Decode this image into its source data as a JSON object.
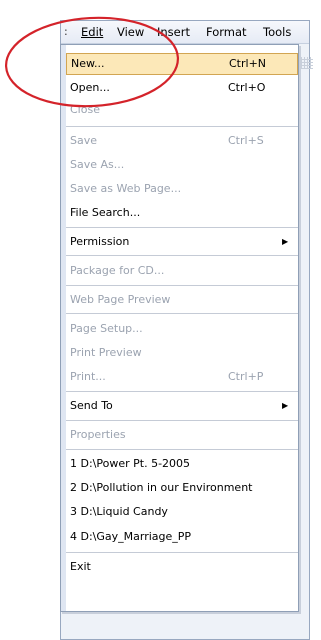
{
  "menubar": {
    "sliver": ":",
    "items": [
      "Edit",
      "View",
      "Insert",
      "Format",
      "Tools"
    ],
    "mnemonic_index": [
      0,
      0,
      0,
      1,
      0
    ]
  },
  "menu": {
    "new": {
      "label": "New...",
      "shortcut": "Ctrl+N"
    },
    "open": {
      "label": "Open...",
      "shortcut": "Ctrl+O"
    },
    "close": {
      "label": "Close"
    },
    "save": {
      "label": "Save",
      "shortcut": "Ctrl+S"
    },
    "save_as": {
      "label": "Save As..."
    },
    "save_web": {
      "label": "Save as Web Page..."
    },
    "file_search": {
      "label": "File Search..."
    },
    "permission": {
      "label": "Permission"
    },
    "package_cd": {
      "label": "Package for CD..."
    },
    "web_preview": {
      "label": "Web Page Preview"
    },
    "page_setup": {
      "label": "Page Setup..."
    },
    "print_preview": {
      "label": "Print Preview"
    },
    "print": {
      "label": "Print...",
      "shortcut": "Ctrl+P"
    },
    "send_to": {
      "label": "Send To"
    },
    "properties": {
      "label": "Properties"
    },
    "recent": [
      {
        "label": "1 D:\\Power Pt. 5-2005"
      },
      {
        "label": "2 D:\\Pollution in our Environment"
      },
      {
        "label": "3 D:\\Liquid Candy"
      },
      {
        "label": "4 D:\\Gay_Marriage_PP"
      }
    ],
    "exit": {
      "label": "Exit"
    }
  },
  "colors": {
    "highlight": "#fce8b8",
    "circle": "#d4232a",
    "disabled": "#9ba3b0"
  }
}
